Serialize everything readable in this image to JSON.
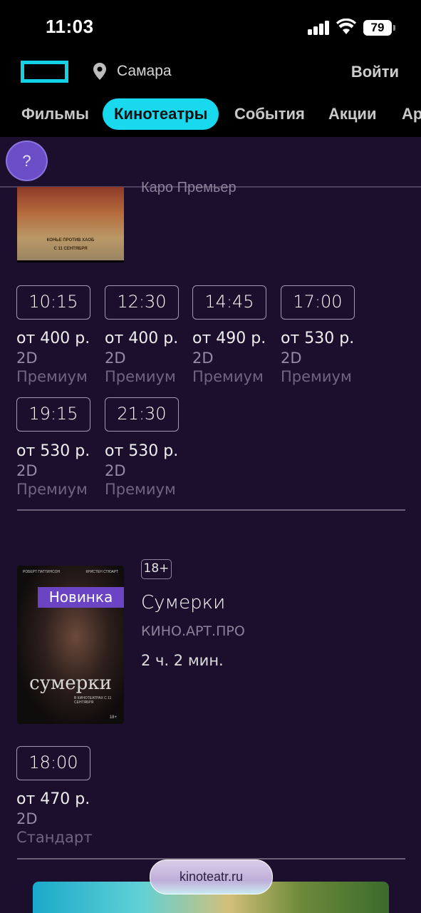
{
  "status_bar": {
    "time": "11:03",
    "battery": "79"
  },
  "header": {
    "city": "Самара",
    "login": "Войти",
    "nav": [
      "Фильмы",
      "Кинотеатры",
      "События",
      "Акции",
      "Ар"
    ]
  },
  "help": "?",
  "movie1": {
    "cinema": "Каро Премьер",
    "sessions": [
      {
        "time": "10:15",
        "price": "от 400 р.",
        "format": "2D",
        "hall": "Премиум"
      },
      {
        "time": "12:30",
        "price": "от 400 р.",
        "format": "2D",
        "hall": "Премиум"
      },
      {
        "time": "14:45",
        "price": "от 490 р.",
        "format": "2D",
        "hall": "Премиум"
      },
      {
        "time": "17:00",
        "price": "от 530 р.",
        "format": "2D",
        "hall": "Премиум"
      },
      {
        "time": "19:15",
        "price": "от 530 р.",
        "format": "2D",
        "hall": "Премиум"
      },
      {
        "time": "21:30",
        "price": "от 530 р.",
        "format": "2D",
        "hall": "Премиум"
      }
    ],
    "poster_text": [
      "КОНЬЕ ПРОТИВ ХАОБ",
      "С 11 СЕНТЯБРЯ"
    ]
  },
  "movie2": {
    "badge": "Новинка",
    "age": "18+",
    "title": "Сумерки",
    "cinema": "КИНО.АРТ.ПРО",
    "duration": "2 ч. 2 мин.",
    "poster": {
      "actors": [
        "РОБЕРТ ПАТТИНСОН",
        "КРИСТЕН СТЮАРТ"
      ],
      "title": "сумерки",
      "subtitle": "В КИНОТЕАТРАХ С 11 СЕНТЯБРЯ",
      "age": "18+"
    },
    "sessions": [
      {
        "time": "18:00",
        "price": "от 470 р.",
        "format": "2D",
        "hall": "Стандарт"
      }
    ]
  },
  "footer": {
    "url": "kinoteatr.ru"
  },
  "colors": {
    "accent": "#19d9ee",
    "background": "#1c0f2e",
    "badge": "#6a44c2"
  }
}
